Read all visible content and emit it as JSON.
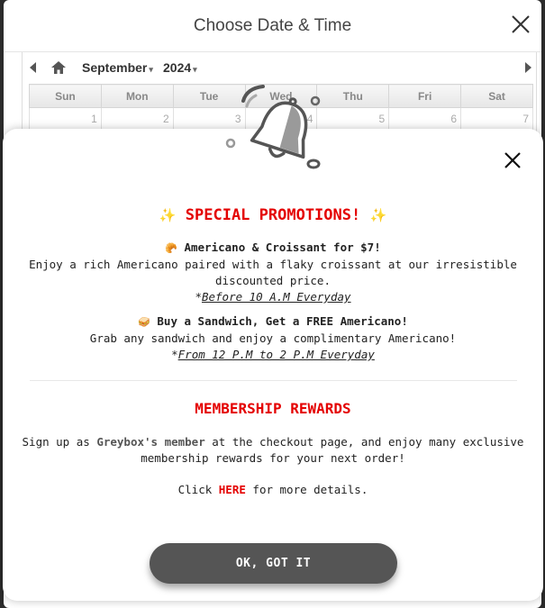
{
  "date_time_modal": {
    "title": "Choose Date & Time",
    "calendar": {
      "month": "September",
      "year": "2024",
      "weekdays": [
        "Sun",
        "Mon",
        "Tue",
        "Wed",
        "Thu",
        "Fri",
        "Sat"
      ],
      "first_row": [
        "1",
        "2",
        "3",
        "4",
        "5",
        "6",
        "7"
      ]
    }
  },
  "promo": {
    "icon": "bell-icon",
    "title": "SPECIAL PROMOTIONS!",
    "title_sparkle": "✨",
    "offers": [
      {
        "emoji": "🥐",
        "name": "Americano & Croissant for $7!",
        "description": "Enjoy a rich Americano paired with a flaky croissant at our irresistible discounted price.",
        "note_prefix": "*",
        "note": "Before 10 A.M Everyday"
      },
      {
        "emoji": "🥪",
        "name": "Buy a Sandwich, Get a FREE Americano!",
        "description": "Grab any sandwich and enjoy a complimentary Americano!",
        "note_prefix": "*",
        "note": "From 12 P.M to 2 P.M Everyday"
      }
    ],
    "membership": {
      "title": "MEMBERSHIP REWARDS",
      "text_before": "Sign up as ",
      "brand": "Greybox's member",
      "text_after": " at the checkout page, and enjoy many exclusive membership rewards for your next order!",
      "click_prefix": "Click ",
      "link_label": "HERE",
      "click_suffix": " for more details."
    },
    "ok_button": "OK, GOT IT"
  },
  "colors": {
    "accent_red": "#e40000",
    "button_grey": "#555555",
    "sparkle_gold": "#f5b800"
  }
}
